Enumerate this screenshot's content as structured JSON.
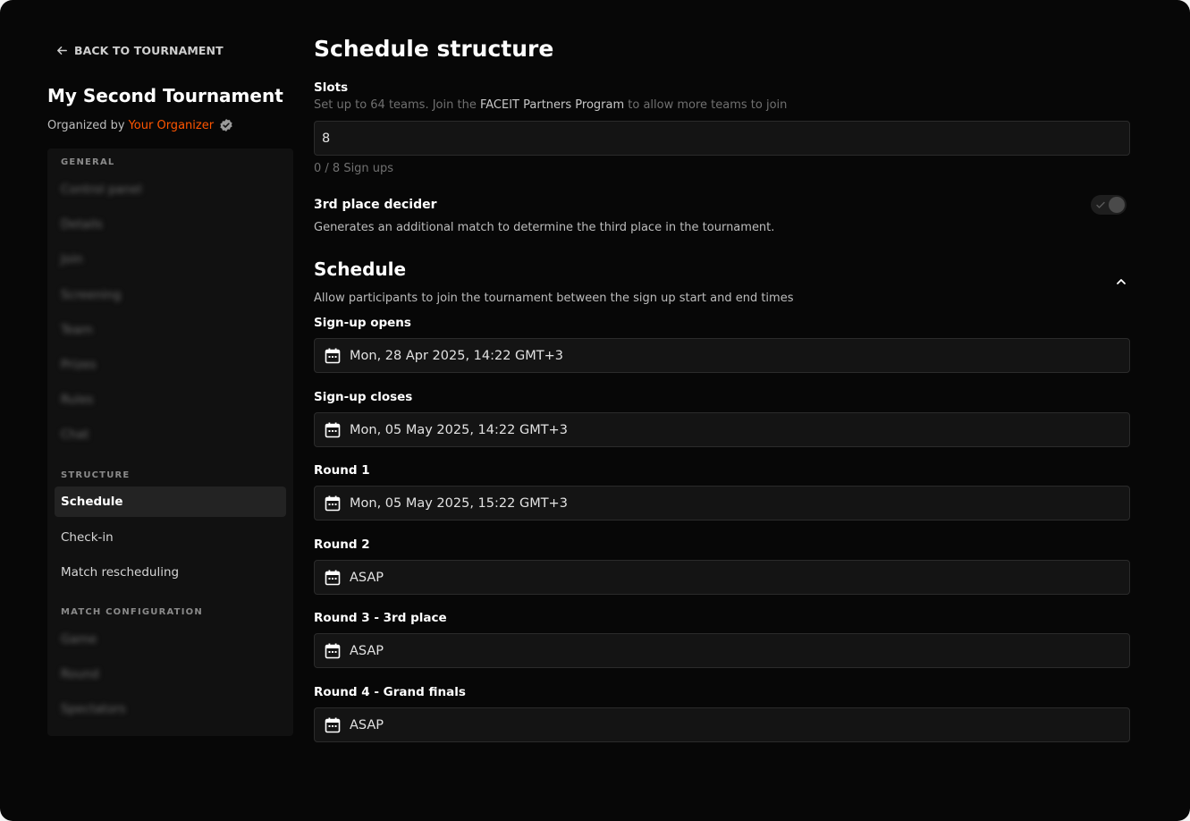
{
  "back_link": "BACK TO TOURNAMENT",
  "tournament": {
    "title": "My Second Tournament",
    "organized_by": "Organized by",
    "organizer": "Your Organizer"
  },
  "sidebar": {
    "general_head": "GENERAL",
    "general_items": [
      "Control panel",
      "Details",
      "Join",
      "Screening",
      "Team",
      "Prizes",
      "Rules",
      "Chat"
    ],
    "structure_head": "STRUCTURE",
    "structure_items": [
      "Schedule",
      "Check-in",
      "Match rescheduling"
    ],
    "match_head": "MATCH CONFIGURATION",
    "match_items": [
      "Game",
      "Round",
      "Spectators"
    ]
  },
  "main": {
    "title": "Schedule structure",
    "slots": {
      "label": "Slots",
      "help_pre": "Set up to 64 teams. Join the",
      "help_link": "FACEIT Partners Program",
      "help_post": "to allow more teams to join",
      "value": "8",
      "signups": "0 / 8 Sign ups"
    },
    "third_place": {
      "label": "3rd place decider",
      "desc": "Generates an additional match to determine the third place in the tournament."
    },
    "schedule": {
      "heading": "Schedule",
      "desc": "Allow participants to join the tournament between the sign up start and end times",
      "fields": [
        {
          "label": "Sign-up opens",
          "value": "Mon, 28 Apr 2025, 14:22 GMT+3"
        },
        {
          "label": "Sign-up closes",
          "value": "Mon, 05 May 2025, 14:22 GMT+3"
        },
        {
          "label": "Round 1",
          "value": "Mon, 05 May 2025, 15:22 GMT+3"
        },
        {
          "label": "Round 2",
          "value": "ASAP"
        },
        {
          "label": "Round 3 - 3rd place",
          "value": "ASAP"
        },
        {
          "label": "Round 4 - Grand finals",
          "value": "ASAP"
        }
      ]
    }
  },
  "colors": {
    "accent": "#ff5500",
    "background": "#070707",
    "panel": "#111111"
  },
  "icons": [
    "arrow-left-icon",
    "verified-badge-icon",
    "calendar-icon",
    "chevron-up-icon",
    "check-icon"
  ]
}
